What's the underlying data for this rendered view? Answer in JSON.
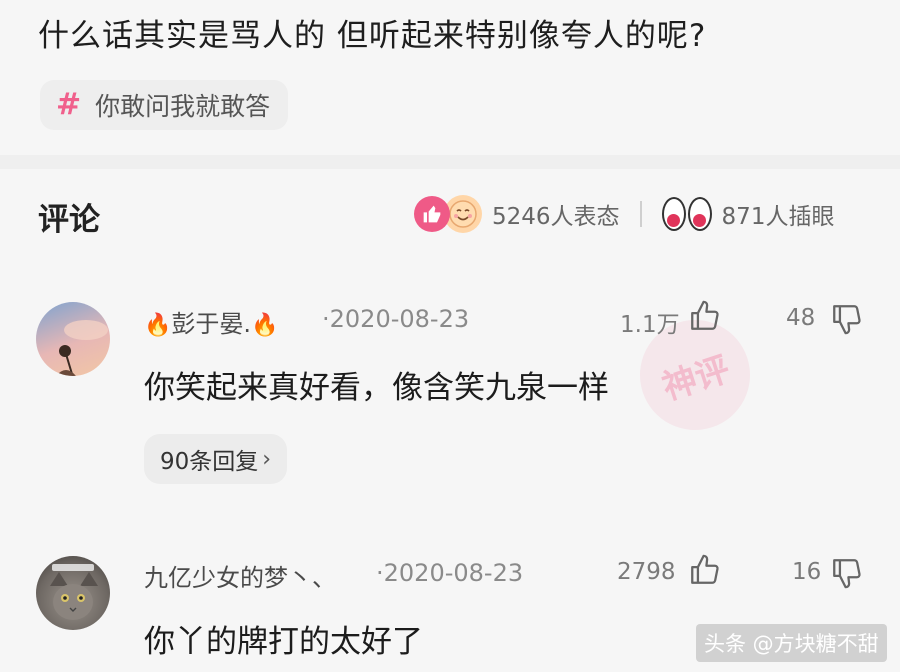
{
  "post": {
    "title": "什么话其实是骂人的  但听起来特别像夸人的呢?",
    "topic": {
      "hash": "#",
      "label": "你敢问我就敢答"
    }
  },
  "comments_section": {
    "header": "评论",
    "reactions_text": "5246人表态",
    "eyes_text": "871人插眼"
  },
  "comments": [
    {
      "username": "彭于晏.",
      "date": "·2020-08-23",
      "likes": "1.1万",
      "dislikes": "48",
      "text": "你笑起来真好看，像含笑九泉一样",
      "replies": "90条回复"
    },
    {
      "username": "九亿少女的梦丶、",
      "date": "·2020-08-23",
      "likes": "2798",
      "dislikes": "16",
      "text": "你丫的牌打的太好了"
    }
  ],
  "stamp_text": "神评",
  "watermark": "头条 @方块糖不甜",
  "colors": {
    "accent_pink": "#ef5a87",
    "background": "#f6f6f6"
  },
  "icons": [
    "hash-icon",
    "like-reaction-icon",
    "smile-face-icon",
    "eyes-icon",
    "fire-icon",
    "thumbs-up-icon",
    "thumbs-down-icon",
    "chevron-right-icon"
  ]
}
